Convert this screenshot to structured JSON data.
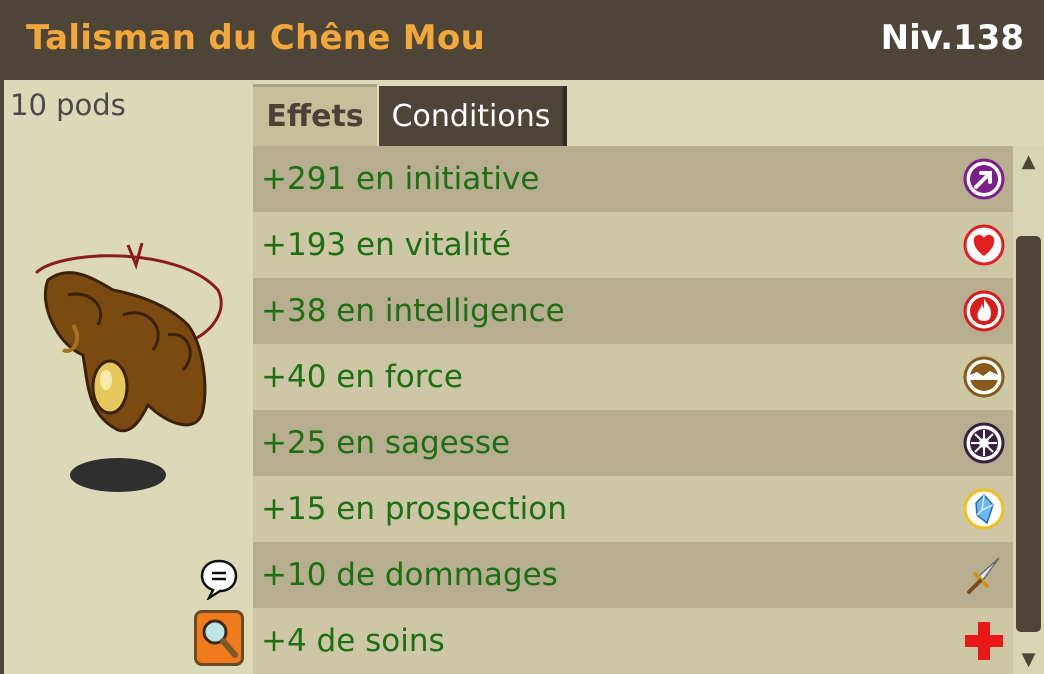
{
  "item": {
    "name": "Talisman du Chêne Mou",
    "level": "Niv.138",
    "weight": "10 pods"
  },
  "tabs": [
    {
      "label": "Effets",
      "active": true
    },
    {
      "label": "Conditions",
      "active": false
    }
  ],
  "effects": [
    {
      "text": "+291 en initiative",
      "icon": "initiative-icon"
    },
    {
      "text": "+193 en vitalité",
      "icon": "vitality-heart-icon"
    },
    {
      "text": "+38 en intelligence",
      "icon": "intelligence-fire-icon"
    },
    {
      "text": "+40 en force",
      "icon": "strength-earth-icon"
    },
    {
      "text": "+25 en sagesse",
      "icon": "wisdom-icon"
    },
    {
      "text": "+15 en prospection",
      "icon": "prospecting-crystal-icon"
    },
    {
      "text": "+10 de dommages",
      "icon": "damage-sword-icon"
    },
    {
      "text": "+4 de soins",
      "icon": "heals-cross-icon"
    }
  ],
  "colors": {
    "title": "#f1a73a",
    "effect_text": "#1d6f14",
    "dark": "#4d4538",
    "panel": "#dcd9b9"
  }
}
